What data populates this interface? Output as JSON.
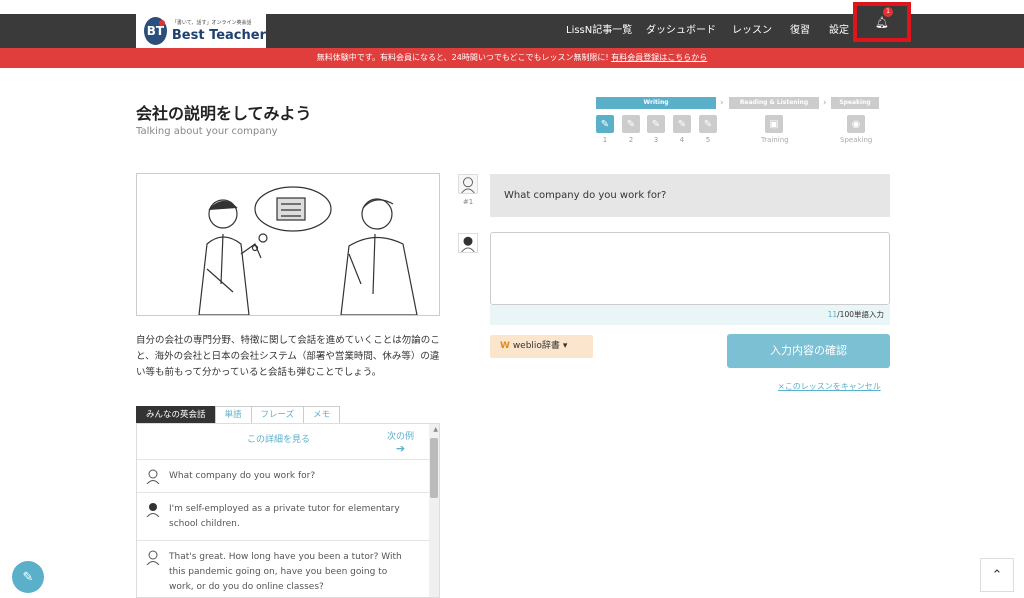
{
  "header": {
    "logo_tagline": "「書いて、話す」オンライン英会話",
    "logo_mark": "BT",
    "logo_name": "Best Teacher",
    "nav": [
      "LissN記事一覧",
      "ダッシュボード",
      "レッスン",
      "復習",
      "設定"
    ],
    "notification_count": "1"
  },
  "banner": {
    "text": "無料体験中です。有料会員になると、24時間いつでもどこでもレッスン無制限に!",
    "link": "有料会員登録はこちらから"
  },
  "lesson": {
    "title": "会社の説明をしてみよう",
    "subtitle": "Talking about your company",
    "description": "自分の会社の専門分野、特徴に関して会話を進めていくことは勿論のこと、海外の会社と日本の会社システム（部署や営業時間、休み等）の違い等も前もって分かっていると会話も弾むことでしょう。"
  },
  "progress": {
    "stages": [
      "Writing",
      "Reading & Listening",
      "Speaking"
    ],
    "steps": [
      "1",
      "2",
      "3",
      "4",
      "5"
    ],
    "training_label": "Training",
    "speaking_label": "Speaking"
  },
  "tabs": [
    "みんなの英会話",
    "単語",
    "フレーズ",
    "メモ"
  ],
  "panel": {
    "detail_link": "この詳細を見る",
    "next_link": "次の例",
    "conversation": [
      "What company do you work for?",
      "I'm self-employed as a private tutor for elementary school children.",
      "That's great. How long have you been a tutor? With this pandemic going on, have you been going to work, or do you do online classes?"
    ]
  },
  "chat": {
    "question_number": "#1",
    "question": "What company do you work for?",
    "answer_value": "",
    "word_count": "11",
    "word_count_suffix": "/100単語入力"
  },
  "actions": {
    "weblio": "weblio辞書",
    "confirm": "入力内容の確認",
    "cancel": "×このレッスンをキャンセル"
  },
  "colors": {
    "accent": "#5bb0c9",
    "banner": "#e03d3d",
    "header": "#3a3a3a",
    "highlight": "#e0141b"
  }
}
